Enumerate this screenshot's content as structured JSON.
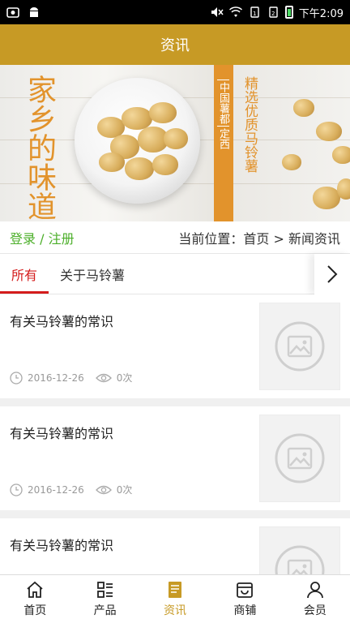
{
  "status": {
    "time": "下午2:09"
  },
  "header": {
    "title": "资讯"
  },
  "banner": {
    "slogan": "家乡的味道",
    "tag_line1": "中国薯都",
    "tag_line2": "定西",
    "tagline": "精选优质马铃薯"
  },
  "locbar": {
    "login": "登录 / 注册",
    "breadcrumb": "当前位置：首页 > 新闻资讯"
  },
  "tabs": [
    {
      "label": "所有",
      "active": true
    },
    {
      "label": "关于马铃薯",
      "active": false
    }
  ],
  "articles": [
    {
      "title": "有关马铃薯的常识",
      "date": "2016-12-26",
      "views": "0次"
    },
    {
      "title": "有关马铃薯的常识",
      "date": "2016-12-26",
      "views": "0次"
    },
    {
      "title": "有关马铃薯的常识",
      "date": "",
      "views": ""
    }
  ],
  "nav": [
    {
      "label": "首页",
      "icon": "home-icon"
    },
    {
      "label": "产品",
      "icon": "grid-list-icon"
    },
    {
      "label": "资讯",
      "icon": "news-icon"
    },
    {
      "label": "商铺",
      "icon": "shop-icon"
    },
    {
      "label": "会员",
      "icon": "user-icon"
    }
  ],
  "colors": {
    "brand": "#c79a25",
    "accent": "#e2932c",
    "tab_active": "#d41c1c",
    "login": "#4caf2a"
  }
}
